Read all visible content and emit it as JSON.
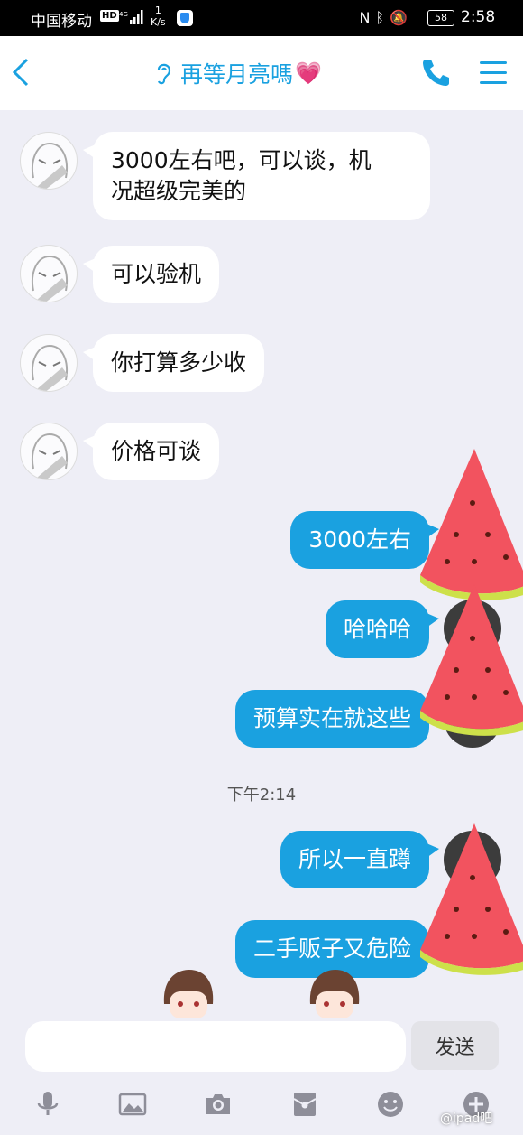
{
  "status_bar": {
    "carrier": "中国移动",
    "hd": "HD",
    "network": "4G",
    "speed_value": "1",
    "speed_unit": "K/s",
    "battery": "58",
    "time": "2:58"
  },
  "header": {
    "title": "再等月亮嗎",
    "icons": [
      "back-arrow-icon",
      "ear-icon",
      "heart-emoji",
      "phone-icon",
      "menu-icon"
    ]
  },
  "messages": [
    {
      "side": "in",
      "text_line1": "3000左右吧，可以谈，机",
      "text_line2": "况超级完美的"
    },
    {
      "side": "in",
      "text": "可以验机"
    },
    {
      "side": "in",
      "text": "你打算多少收"
    },
    {
      "side": "in",
      "text": "价格可谈"
    },
    {
      "side": "out",
      "text": "3000左右"
    },
    {
      "side": "out",
      "text": "哈哈哈"
    },
    {
      "side": "out",
      "text": "预算实在就这些"
    },
    {
      "side": "out",
      "text": "所以一直蹲"
    },
    {
      "side": "out",
      "text": "二手贩子又危险"
    }
  ],
  "timestamp": "下午2:14",
  "input": {
    "placeholder": "",
    "send_label": "发送"
  },
  "toolbar": [
    "microphone-icon",
    "image-icon",
    "camera-icon",
    "red-packet-icon",
    "emoji-icon",
    "plus-icon"
  ],
  "watermark": "@ipad吧",
  "colors": {
    "accent": "#1aa1e0",
    "background": "#eeeef6",
    "bubble_in": "#ffffff",
    "bubble_out": "#1aa1e0",
    "watermelon": "#f2535f"
  }
}
